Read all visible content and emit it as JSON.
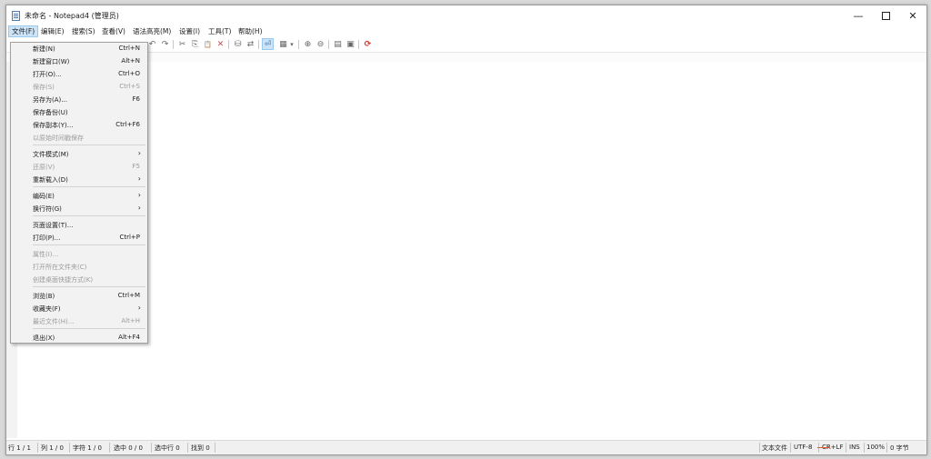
{
  "window": {
    "title": "未命名 - Notepad4 (管理员)",
    "minimize_icon": "minimize-icon",
    "maximize_icon": "maximize-icon",
    "close_icon": "close-icon"
  },
  "menubar": [
    {
      "label": "文件(F)",
      "active": true
    },
    {
      "label": "编辑(E)"
    },
    {
      "label": "搜索(S)"
    },
    {
      "label": "查看(V)"
    },
    {
      "label": "语法高亮(M)"
    },
    {
      "label": "设置(I)"
    },
    {
      "label": "工具(T)"
    },
    {
      "label": "帮助(H)"
    }
  ],
  "toolbar": {
    "undo_icon": "↶",
    "redo_icon": "↷",
    "cut_icon": "✂",
    "copy_icon": "⎘",
    "paste_icon": "📋",
    "delete_icon": "✕",
    "find_icon": "⛁",
    "replace_icon": "⇄",
    "wordwrap_icon": "⏎",
    "scheme_icon": "▦",
    "dropdown_icon": "▾",
    "zoomin_icon": "⊕",
    "zoomout_icon": "⊖",
    "settings_icon": "▤",
    "save_icon": "▣",
    "exit_icon": "⟳"
  },
  "file_menu": {
    "items": [
      {
        "label": "新建(N)",
        "shortcut": "Ctrl+N"
      },
      {
        "label": "新建窗口(W)",
        "shortcut": "Alt+N"
      },
      {
        "label": "打开(O)...",
        "shortcut": "Ctrl+O"
      },
      {
        "label": "保存(S)",
        "shortcut": "Ctrl+S",
        "disabled": true
      },
      {
        "label": "另存为(A)...",
        "shortcut": "F6"
      },
      {
        "label": "保存备份(U)",
        "shortcut": ""
      },
      {
        "label": "保存副本(Y)...",
        "shortcut": "Ctrl+F6"
      },
      {
        "label": "以原始时间戳保存",
        "shortcut": "",
        "disabled": true
      },
      {
        "label": "文件模式(M)",
        "submenu": true
      },
      {
        "label": "还原(V)",
        "shortcut": "F5",
        "disabled": true
      },
      {
        "label": "重新载入(D)",
        "submenu": true
      },
      {
        "label": "编码(E)",
        "submenu": true
      },
      {
        "label": "换行符(G)",
        "submenu": true
      },
      {
        "label": "页面设置(T)...",
        "shortcut": ""
      },
      {
        "label": "打印(P)...",
        "shortcut": "Ctrl+P"
      },
      {
        "label": "属性(I)...",
        "shortcut": "",
        "disabled": true
      },
      {
        "label": "打开所在文件夹(C)",
        "shortcut": "",
        "disabled": true
      },
      {
        "label": "创建桌面快捷方式(K)",
        "shortcut": "",
        "disabled": true
      },
      {
        "label": "浏览(B)",
        "shortcut": "Ctrl+M"
      },
      {
        "label": "收藏夹(F)",
        "submenu": true
      },
      {
        "label": "最近文件(H)...",
        "shortcut": "Alt+H",
        "disabled": true
      },
      {
        "label": "退出(X)",
        "shortcut": "Alt+F4"
      }
    ],
    "submenu_arrow": "›"
  },
  "statusbar": {
    "line": "行 1 / 1",
    "column": "列 1 / 0",
    "char": "字符 1 / 0",
    "selection": "选中 0 / 0",
    "selected_lines": "选中行 0",
    "found": "找到 0",
    "lexer": "文本文件",
    "encoding": "UTF-8",
    "eol": "CR+LF",
    "mode": "INS",
    "zoom": "100%",
    "size": "0 字节"
  },
  "colors": {
    "menu_active_bg": "#cce4f7",
    "eol_underline": "#e05a2a",
    "exit_icon": "#d93025"
  }
}
